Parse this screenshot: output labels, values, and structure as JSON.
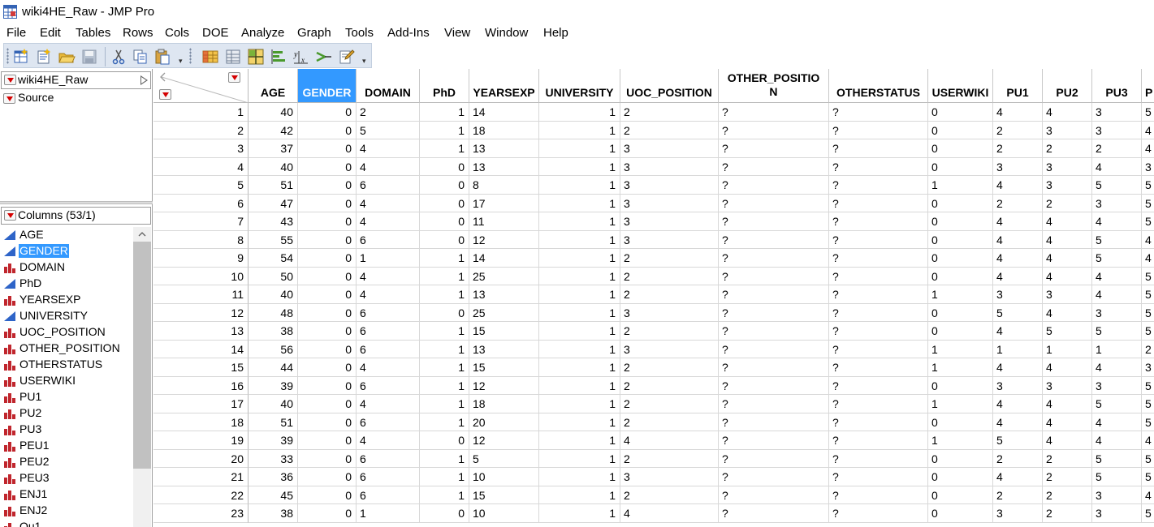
{
  "window": {
    "title": "wiki4HE_Raw - JMP Pro"
  },
  "menu": [
    "File",
    "Edit",
    "Tables",
    "Rows",
    "Cols",
    "DOE",
    "Analyze",
    "Graph",
    "Tools",
    "Add-Ins",
    "View",
    "Window",
    "Help"
  ],
  "toolbar": {
    "buttons": [
      "new-data-table-icon",
      "new-script-icon",
      "open-folder-icon",
      "save-icon",
      "cut-icon",
      "copy-icon",
      "paste-icon",
      "data-grid-icon",
      "table-list-icon",
      "tile-icon",
      "bar-graph-icon",
      "fit-model-icon",
      "arrow-icon",
      "edit-pencil-icon"
    ]
  },
  "table_panel": {
    "table_name": "wiki4HE_Raw",
    "source_label": "Source",
    "columns_header": "Columns (53/1)",
    "columns": [
      {
        "name": "AGE",
        "type": "continuous"
      },
      {
        "name": "GENDER",
        "type": "continuous",
        "selected": true
      },
      {
        "name": "DOMAIN",
        "type": "nominal"
      },
      {
        "name": "PhD",
        "type": "continuous"
      },
      {
        "name": "YEARSEXP",
        "type": "nominal"
      },
      {
        "name": "UNIVERSITY",
        "type": "continuous"
      },
      {
        "name": "UOC_POSITION",
        "type": "nominal"
      },
      {
        "name": "OTHER_POSITION",
        "type": "nominal"
      },
      {
        "name": "OTHERSTATUS",
        "type": "nominal"
      },
      {
        "name": "USERWIKI",
        "type": "nominal"
      },
      {
        "name": "PU1",
        "type": "nominal"
      },
      {
        "name": "PU2",
        "type": "nominal"
      },
      {
        "name": "PU3",
        "type": "nominal"
      },
      {
        "name": "PEU1",
        "type": "nominal"
      },
      {
        "name": "PEU2",
        "type": "nominal"
      },
      {
        "name": "PEU3",
        "type": "nominal"
      },
      {
        "name": "ENJ1",
        "type": "nominal"
      },
      {
        "name": "ENJ2",
        "type": "nominal"
      },
      {
        "name": "Qu1",
        "type": "nominal"
      }
    ]
  },
  "grid": {
    "headers": [
      "AGE",
      "GENDER",
      "DOMAIN",
      "PhD",
      "YEARSEXP",
      "UNIVERSITY",
      "UOC_POSITION",
      "OTHER_POSITION",
      "OTHERSTATUS",
      "USERWIKI",
      "PU1",
      "PU2",
      "PU3",
      "PEU1"
    ],
    "header_lines": {
      "OTHER_POSITION": [
        "OTHER_POSITIO",
        "N"
      ]
    },
    "header_partial": {
      "PEU1": "P"
    },
    "selected_column": "GENDER",
    "align": [
      "r",
      "r",
      "l",
      "r",
      "l",
      "r",
      "l",
      "l",
      "l",
      "l",
      "l",
      "l",
      "l",
      "l"
    ],
    "rows": [
      [
        "1",
        "40",
        "0",
        "2",
        "1",
        "14",
        "1",
        "2",
        "?",
        "?",
        "0",
        "4",
        "4",
        "3",
        "5"
      ],
      [
        "2",
        "42",
        "0",
        "5",
        "1",
        "18",
        "1",
        "2",
        "?",
        "?",
        "0",
        "2",
        "3",
        "3",
        "4"
      ],
      [
        "3",
        "37",
        "0",
        "4",
        "1",
        "13",
        "1",
        "3",
        "?",
        "?",
        "0",
        "2",
        "2",
        "2",
        "4"
      ],
      [
        "4",
        "40",
        "0",
        "4",
        "0",
        "13",
        "1",
        "3",
        "?",
        "?",
        "0",
        "3",
        "3",
        "4",
        "3"
      ],
      [
        "5",
        "51",
        "0",
        "6",
        "0",
        "8",
        "1",
        "3",
        "?",
        "?",
        "1",
        "4",
        "3",
        "5",
        "5"
      ],
      [
        "6",
        "47",
        "0",
        "4",
        "0",
        "17",
        "1",
        "3",
        "?",
        "?",
        "0",
        "2",
        "2",
        "3",
        "5"
      ],
      [
        "7",
        "43",
        "0",
        "4",
        "0",
        "11",
        "1",
        "3",
        "?",
        "?",
        "0",
        "4",
        "4",
        "4",
        "5"
      ],
      [
        "8",
        "55",
        "0",
        "6",
        "0",
        "12",
        "1",
        "3",
        "?",
        "?",
        "0",
        "4",
        "4",
        "5",
        "4"
      ],
      [
        "9",
        "54",
        "0",
        "1",
        "1",
        "14",
        "1",
        "2",
        "?",
        "?",
        "0",
        "4",
        "4",
        "5",
        "4"
      ],
      [
        "10",
        "50",
        "0",
        "4",
        "1",
        "25",
        "1",
        "2",
        "?",
        "?",
        "0",
        "4",
        "4",
        "4",
        "5"
      ],
      [
        "11",
        "40",
        "0",
        "4",
        "1",
        "13",
        "1",
        "2",
        "?",
        "?",
        "1",
        "3",
        "3",
        "4",
        "5"
      ],
      [
        "12",
        "48",
        "0",
        "6",
        "0",
        "25",
        "1",
        "3",
        "?",
        "?",
        "0",
        "5",
        "4",
        "3",
        "5"
      ],
      [
        "13",
        "38",
        "0",
        "6",
        "1",
        "15",
        "1",
        "2",
        "?",
        "?",
        "0",
        "4",
        "5",
        "5",
        "5"
      ],
      [
        "14",
        "56",
        "0",
        "6",
        "1",
        "13",
        "1",
        "3",
        "?",
        "?",
        "1",
        "1",
        "1",
        "1",
        "2"
      ],
      [
        "15",
        "44",
        "0",
        "4",
        "1",
        "15",
        "1",
        "2",
        "?",
        "?",
        "1",
        "4",
        "4",
        "4",
        "3"
      ],
      [
        "16",
        "39",
        "0",
        "6",
        "1",
        "12",
        "1",
        "2",
        "?",
        "?",
        "0",
        "3",
        "3",
        "3",
        "5"
      ],
      [
        "17",
        "40",
        "0",
        "4",
        "1",
        "18",
        "1",
        "2",
        "?",
        "?",
        "1",
        "4",
        "4",
        "5",
        "5"
      ],
      [
        "18",
        "51",
        "0",
        "6",
        "1",
        "20",
        "1",
        "2",
        "?",
        "?",
        "0",
        "4",
        "4",
        "4",
        "5"
      ],
      [
        "19",
        "39",
        "0",
        "4",
        "0",
        "12",
        "1",
        "4",
        "?",
        "?",
        "1",
        "5",
        "4",
        "4",
        "4"
      ],
      [
        "20",
        "33",
        "0",
        "6",
        "1",
        "5",
        "1",
        "2",
        "?",
        "?",
        "0",
        "2",
        "2",
        "5",
        "5"
      ],
      [
        "21",
        "36",
        "0",
        "6",
        "1",
        "10",
        "1",
        "3",
        "?",
        "?",
        "0",
        "4",
        "2",
        "5",
        "5"
      ],
      [
        "22",
        "45",
        "0",
        "6",
        "1",
        "15",
        "1",
        "2",
        "?",
        "?",
        "0",
        "2",
        "2",
        "3",
        "4"
      ],
      [
        "23",
        "38",
        "0",
        "1",
        "0",
        "10",
        "1",
        "4",
        "?",
        "?",
        "0",
        "3",
        "2",
        "3",
        "5"
      ]
    ]
  },
  "colors": {
    "selection": "#3399ff",
    "toolbar_bg": "#dee6f1",
    "red_triangle": "#d40000",
    "continuous_icon": "#2e64c8",
    "nominal_icon": "#c0262d"
  }
}
